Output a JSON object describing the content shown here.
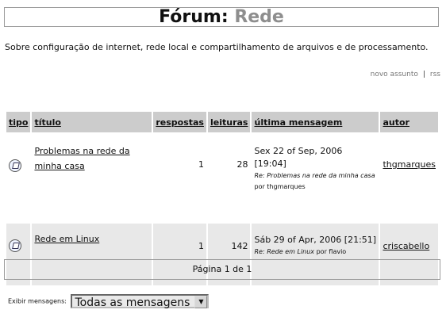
{
  "header": {
    "prefix": "Fórum:",
    "forum_name": "Rede"
  },
  "description": "Sobre configuração de internet, rede local e compartilhamento de arquivos e de processamento.",
  "toplinks": {
    "new_topic": "novo assunto",
    "separator": "|",
    "rss": "rss"
  },
  "table": {
    "headers": {
      "type": "tipo",
      "title": "título",
      "replies": "respostas",
      "reads": "leituras",
      "last_post": "última mensagem",
      "author": "autor"
    },
    "rows": [
      {
        "icon": "topic-icon",
        "title": "Problemas na rede da minha casa",
        "replies": "1",
        "reads": "28",
        "last_date": "Sex 22 of Sep, 2006 [19:04]",
        "last_re": "Re: Problemas na rede da minha casa",
        "last_by": "por thgmarques",
        "author": "thgmarques"
      },
      {
        "icon": "topic-icon",
        "title": "Rede em Linux",
        "replies": "1",
        "reads": "142",
        "last_date": "Sáb 29 of Apr, 2006 [21:51]",
        "last_re": "Re: Rede em Linux",
        "last_by": "por flavio",
        "author": "criscabello"
      }
    ]
  },
  "pager": {
    "text": "Página 1 de 1"
  },
  "filter": {
    "label": "Exibir mensagens:",
    "selected": "Todas as mensagens"
  }
}
